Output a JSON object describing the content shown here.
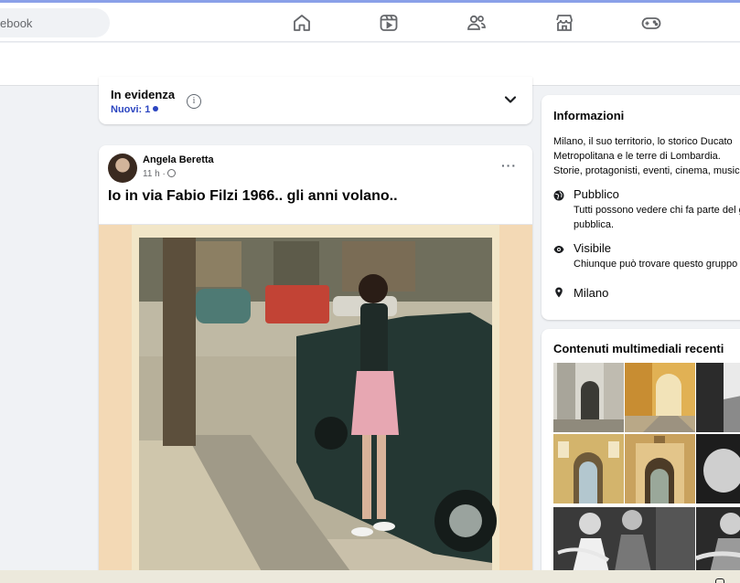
{
  "search": {
    "value": "ebook"
  },
  "nav": [
    {
      "name": "home-icon"
    },
    {
      "name": "video-icon"
    },
    {
      "name": "friends-icon"
    },
    {
      "name": "marketplace-icon"
    },
    {
      "name": "gaming-icon"
    }
  ],
  "featured": {
    "title": "In evidenza",
    "new_label": "Nuovi: 1",
    "info_glyph": "i"
  },
  "post": {
    "author": "Angela Beretta",
    "time": "11 h ·",
    "more": "···",
    "text": "Io in via Fabio Filzi 1966.. gli anni volano.."
  },
  "info": {
    "title": "Informazioni",
    "description_lines": [
      "Milano, il suo territorio, lo storico Ducato",
      "Metropolitana e le terre di Lombardia.",
      "Storie, protagonisti, eventi, cinema, musica"
    ],
    "public_label": "Pubblico",
    "public_sub_lines": [
      "Tutti possono vedere chi fa parte del gruppo",
      "pubblica."
    ],
    "visible_label": "Visibile",
    "visible_sub": "Chiunque può trovare questo gruppo",
    "location": "Milano"
  },
  "media": {
    "title": "Contenuti multimediali recenti"
  },
  "colors": {
    "accent": "#2b45c0",
    "top_stripe": "#8aa0e8",
    "background": "#f0f2f5"
  }
}
